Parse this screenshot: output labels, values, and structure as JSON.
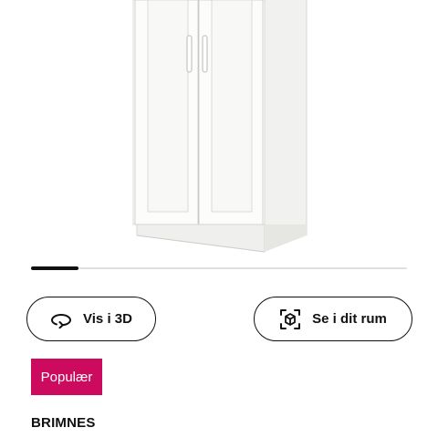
{
  "product_image": {
    "description_icon": "wardrobe-two-doors-white"
  },
  "gallery": {
    "progress_fraction": 0.125
  },
  "actions": {
    "view_3d_label": "Vis i 3D",
    "view_3d_icon": "rotate-360-icon",
    "ar_label": "Se i dit rum",
    "ar_icon": "ar-cube-icon"
  },
  "badge": {
    "label": "Populær",
    "color": "#cc0a5e"
  },
  "product": {
    "name": "BRIMNES"
  }
}
